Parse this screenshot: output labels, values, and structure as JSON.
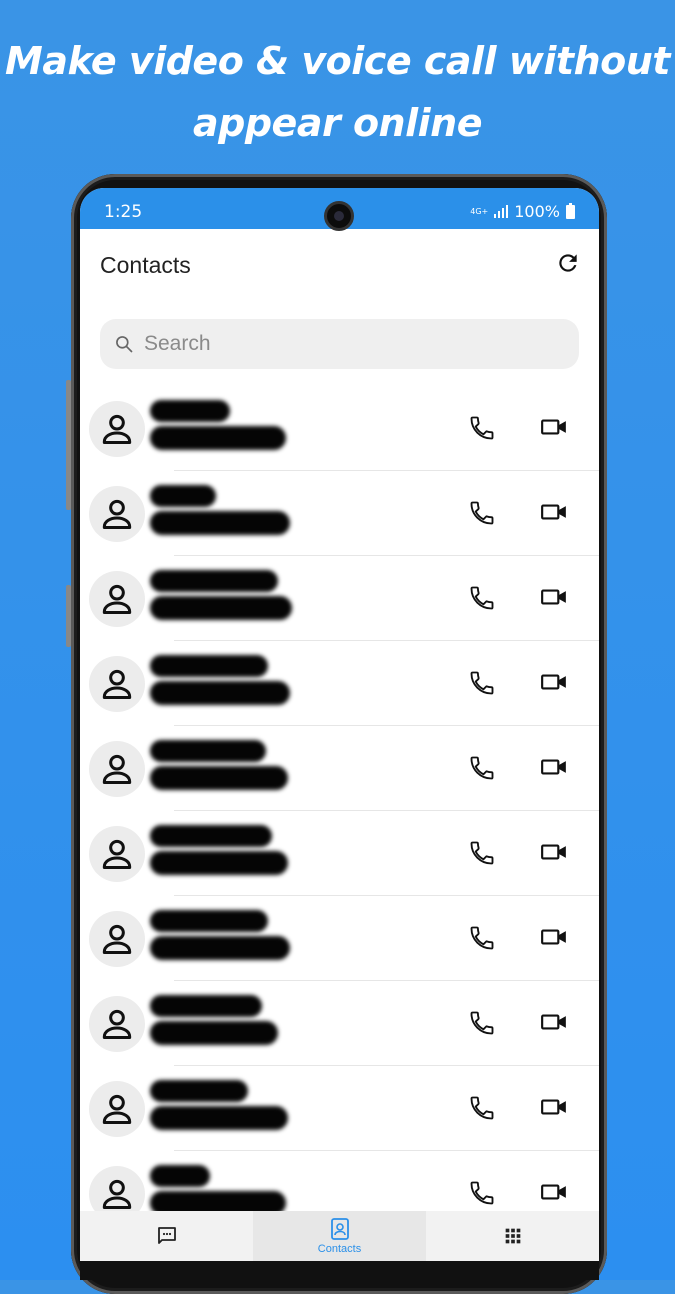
{
  "promo": {
    "headline_line1": "Make video & voice call without",
    "headline_line2": "appear online"
  },
  "status_bar": {
    "time": "1:25",
    "network": "4G+",
    "battery": "100%"
  },
  "header": {
    "title": "Contacts",
    "refresh_icon": "refresh-icon"
  },
  "search": {
    "placeholder": "Search"
  },
  "contacts": [
    {
      "name": "",
      "number": "",
      "name_w": 80,
      "num_w": 136
    },
    {
      "name": "",
      "number": "",
      "name_w": 66,
      "num_w": 140
    },
    {
      "name": "",
      "number": "",
      "name_w": 128,
      "num_w": 142
    },
    {
      "name": "",
      "number": "",
      "name_w": 118,
      "num_w": 140
    },
    {
      "name": "",
      "number": "",
      "name_w": 116,
      "num_w": 138
    },
    {
      "name": "",
      "number": "",
      "name_w": 122,
      "num_w": 138
    },
    {
      "name": "",
      "number": "",
      "name_w": 118,
      "num_w": 140
    },
    {
      "name": "",
      "number": "",
      "name_w": 112,
      "num_w": 128
    },
    {
      "name": "",
      "number": "",
      "name_w": 98,
      "num_w": 138
    },
    {
      "name": "",
      "number": "",
      "name_w": 60,
      "num_w": 136
    }
  ],
  "bottom_nav": {
    "items": [
      {
        "label": "",
        "icon": "chat-icon",
        "active": false
      },
      {
        "label": "Contacts",
        "icon": "contacts-icon",
        "active": true
      },
      {
        "label": "",
        "icon": "dialpad-icon",
        "active": false
      }
    ]
  },
  "colors": {
    "background": "#2c8ff0",
    "accent": "#2b90e9"
  }
}
